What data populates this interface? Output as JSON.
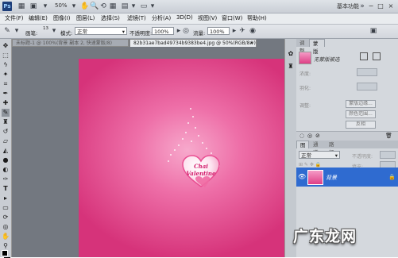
{
  "app": {
    "logo": "Ps",
    "zoom": "50%",
    "workspace": "基本功能",
    "window_controls": [
      "−",
      "□",
      "×"
    ]
  },
  "menu": [
    "文件(F)",
    "编辑(E)",
    "图像(I)",
    "图层(L)",
    "选择(S)",
    "滤镜(T)",
    "分析(A)",
    "3D(D)",
    "视图(V)",
    "窗口(W)",
    "帮助(H)"
  ],
  "options": {
    "brush_label": "画笔:",
    "brush_size": "13",
    "mode_label": "模式:",
    "mode_value": "正常",
    "opacity_label": "不透明度:",
    "opacity_value": "100%",
    "flow_label": "流量:",
    "flow_value": "100%"
  },
  "tabs": [
    {
      "label": "未标题-1 @ 100%(背景 副本 2, 快速蒙版/8)",
      "active": false
    },
    {
      "label": "82b31ae7bad49734b9383be4.jpg @ 50%(RGB/8#)",
      "active": true
    }
  ],
  "artwork": {
    "line1": "Chai",
    "line2": "Valentine"
  },
  "panel_tabs_top": [
    "调整",
    "蒙版"
  ],
  "masks": {
    "title": "无蒙版被选",
    "density_label": "浓度:",
    "feather_label": "羽化:",
    "refine_label": "调整:",
    "buttons": [
      "蒙版边缘...",
      "颜色范围...",
      "反相"
    ]
  },
  "panel_tabs_layers": [
    "图层",
    "通道",
    "路径"
  ],
  "layers": {
    "blend_mode": "正常",
    "opacity_label": "不透明度:",
    "fill_label": "填充:",
    "layer_name": "背景"
  },
  "watermark": "广东龙网",
  "colors": {
    "canvas_pink": "#e1468a",
    "selection_blue": "#2f6bd0"
  }
}
